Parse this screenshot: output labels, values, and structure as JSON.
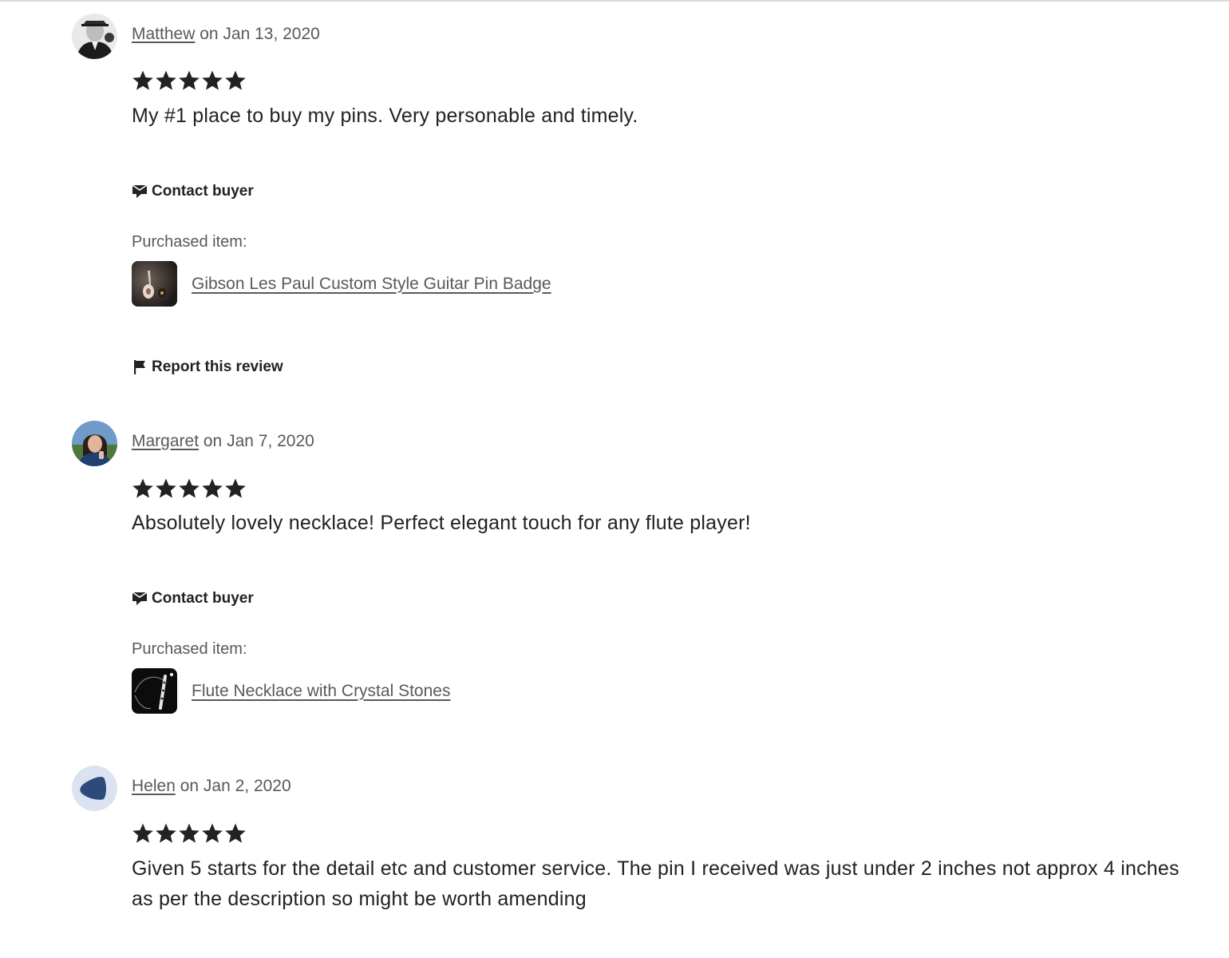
{
  "reviews": [
    {
      "name": "Matthew",
      "date_text": "on Jan 13, 2020",
      "rating": 5,
      "text": "My #1 place to buy my pins. Very personable and timely.",
      "contact_label": "Contact buyer",
      "purchased_label": "Purchased item:",
      "item_title": "Gibson Les Paul Custom Style Guitar Pin Badge",
      "report_label": "Report this review"
    },
    {
      "name": "Margaret",
      "date_text": "on Jan 7, 2020",
      "rating": 5,
      "text": "Absolutely lovely necklace! Perfect elegant touch for any flute player!",
      "contact_label": "Contact buyer",
      "purchased_label": "Purchased item:",
      "item_title": "Flute Necklace with Crystal Stones"
    },
    {
      "name": "Helen",
      "date_text": "on Jan 2, 2020",
      "rating": 5,
      "text": "Given 5 starts for the detail etc and customer service. The pin I received was just under 2 inches not approx 4 inches as per the description so might be worth amending"
    }
  ],
  "icons": {
    "star": "star-icon",
    "contact": "message-icon",
    "report": "flag-icon"
  },
  "colors": {
    "text": "#222222",
    "muted": "#595959",
    "divider": "#d9d9d9",
    "default_avatar_bg": "#dbe3f0",
    "default_avatar_fg": "#2d4a7a"
  }
}
